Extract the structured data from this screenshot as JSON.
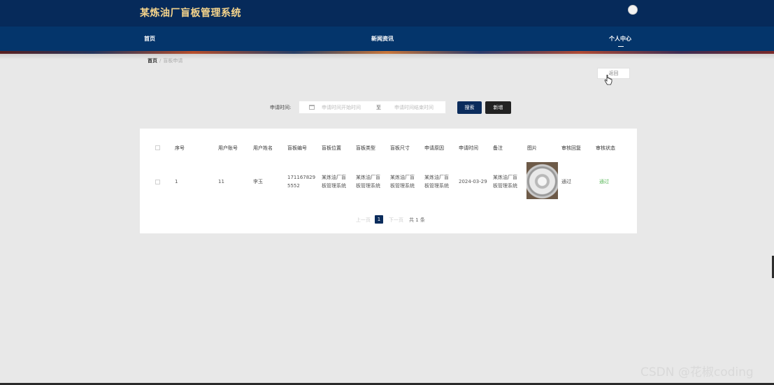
{
  "header": {
    "title": "某炼油厂盲板管理系统"
  },
  "nav": {
    "items": [
      "首页",
      "新闻资讯",
      "个人中心"
    ]
  },
  "breadcrumb": {
    "home": "首页",
    "separator": "/",
    "current": "盲板申请"
  },
  "back_label": "返回",
  "search": {
    "label": "申请时间:",
    "start_placeholder": "申请时间开始时间",
    "range_separator": "至",
    "end_placeholder": "申请时间结束时间",
    "search_label": "搜索",
    "add_label": "新增"
  },
  "table": {
    "headers": [
      "序号",
      "用户账号",
      "用户姓名",
      "盲板编号",
      "盲板位置",
      "盲板类型",
      "盲板尺寸",
      "申请原因",
      "申请时间",
      "备注",
      "图片",
      "审核回复",
      "审核状态"
    ],
    "rows": [
      {
        "index": "1",
        "account": "11",
        "name": "李玉",
        "plate_no_line1": "171167829",
        "plate_no_line2": "5552",
        "position_line1": "某炼油厂盲",
        "position_line2": "板管理系统",
        "type_line1": "某炼油厂盲",
        "type_line2": "板管理系统",
        "size_line1": "某炼油厂盲",
        "size_line2": "板管理系统",
        "reason_line1": "某炼油厂盲",
        "reason_line2": "板管理系统",
        "apply_time": "2024-03-29",
        "remark_line1": "某炼油厂盲",
        "remark_line2": "板管理系统",
        "reply": "通过",
        "status": "通过"
      }
    ]
  },
  "pagination": {
    "prev": "上一页",
    "current": "1",
    "next": "下一页",
    "total": "共 1 条"
  },
  "watermark": "CSDN @花椒coding",
  "colors": {
    "header_bg": "#062a5a",
    "nav_bg": "#04356b",
    "brand_text": "#f5d48c",
    "primary_button": "#0b2c5c",
    "status_ok": "#5cb85c"
  }
}
